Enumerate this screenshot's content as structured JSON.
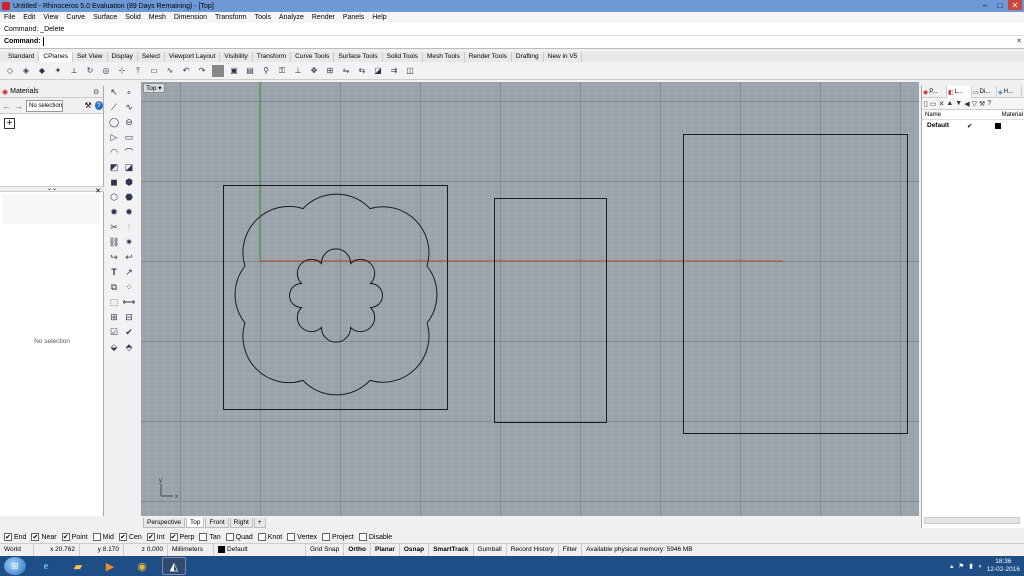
{
  "window": {
    "title": "Untitled - Rhinoceros 5.0 Evaluation (89 Days Remaining) - [Top]",
    "min": "–",
    "max": "□",
    "close": "✕"
  },
  "menu": [
    "File",
    "Edit",
    "View",
    "Curve",
    "Surface",
    "Solid",
    "Mesh",
    "Dimension",
    "Transform",
    "Tools",
    "Analyze",
    "Render",
    "Panels",
    "Help"
  ],
  "command": {
    "history": "Command: _Delete",
    "prompt": "Command:"
  },
  "toolbar_tabs": [
    "Standard",
    "CPlanes",
    "Set View",
    "Display",
    "Select",
    "Viewport Layout",
    "Visibility",
    "Transform",
    "Curve Tools",
    "Surface Tools",
    "Solid Tools",
    "Mesh Tools",
    "Render Tools",
    "Drafting",
    "New in V5"
  ],
  "active_toolbar_tab": "CPlanes",
  "left_panel": {
    "title": "Materials",
    "selection": "No selection",
    "no_selection": "No selection",
    "add": "+"
  },
  "viewport": {
    "label": "Top",
    "axis_y": "y",
    "axis_x": "x"
  },
  "viewport_tabs": [
    "Perspective",
    "Top",
    "Front",
    "Right",
    "+"
  ],
  "right_panel": {
    "tabs": [
      "P...",
      "L...",
      "Di...",
      "H..."
    ],
    "columns": [
      "Name",
      "Material"
    ],
    "layers": [
      {
        "name": "Default",
        "check": "✔"
      }
    ]
  },
  "osnaps": [
    {
      "label": "End",
      "checked": true
    },
    {
      "label": "Near",
      "checked": true
    },
    {
      "label": "Point",
      "checked": true
    },
    {
      "label": "Mid",
      "checked": false
    },
    {
      "label": "Cen",
      "checked": true
    },
    {
      "label": "Int",
      "checked": true
    },
    {
      "label": "Perp",
      "checked": true
    },
    {
      "label": "Tan",
      "checked": false
    },
    {
      "label": "Quad",
      "checked": false
    },
    {
      "label": "Knot",
      "checked": false
    },
    {
      "label": "Vertex",
      "checked": false
    },
    {
      "label": "Project",
      "checked": false
    },
    {
      "label": "Disable",
      "checked": false
    }
  ],
  "status": {
    "cplane": "World",
    "x": "x 20.762",
    "y": "y 8.170",
    "z": "z 0.000",
    "units": "Millimeters",
    "layer": "Default",
    "grid_snap": "Grid Snap",
    "ortho": "Ortho",
    "planar": "Planar",
    "osnap": "Osnap",
    "smarttrack": "SmartTrack",
    "gumball": "Gumball",
    "record_history": "Record History",
    "filter": "Filter",
    "memory": "Available physical memory: 5946 MB"
  },
  "taskbar": {
    "time": "18:36",
    "date": "12-02-2016"
  },
  "colors": {
    "viewport_bg": "#9aa2ab",
    "x_axis": "#b04a2a",
    "y_axis": "#3c9a3c",
    "curves": "#1a1a1a"
  }
}
